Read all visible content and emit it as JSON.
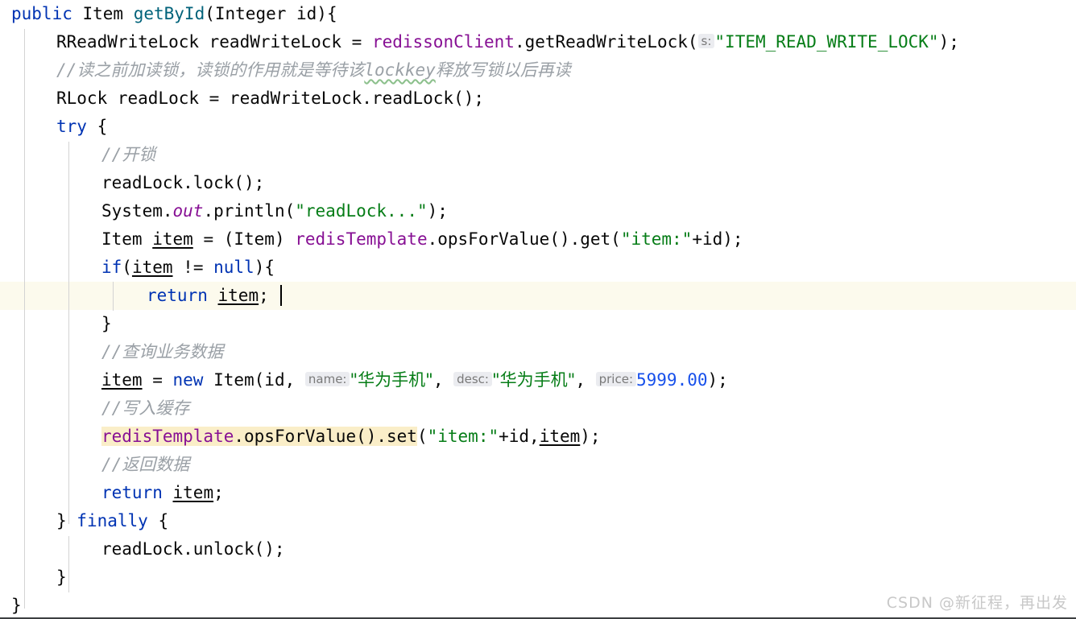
{
  "editor": {
    "language": "Java",
    "theme": "IntelliJ Light",
    "font_size_px": 21,
    "line_height_px": 35,
    "colors": {
      "background": "#ffffff",
      "keyword": "#0033b3",
      "method": "#00627a",
      "field": "#871094",
      "string": "#067d17",
      "number": "#1750eb",
      "comment": "#9aa0a6",
      "default_text": "#080808",
      "caret_line": "#fcfaed",
      "search_highlight": "#faeec8",
      "param_hint_bg": "#ebecf0",
      "param_hint_fg": "#7a7a7a",
      "indent_guide": "#d3d3d3",
      "typo_wave": "#8cc08c"
    },
    "caret_line_number": 9
  },
  "code": {
    "l1": {
      "kw_public": "public",
      "type_item": " Item ",
      "method": "getById",
      "params": "(Integer id){"
    },
    "l2": {
      "type": "RReadWriteLock readWriteLock = ",
      "field": "redissonClient",
      "call": ".getReadWriteLock(",
      "hint": "s:",
      "string": "\"ITEM_READ_WRITE_LOCK\"",
      "tail": ");"
    },
    "l3": {
      "slashes": "//",
      "pre": "读之前加读锁，读锁的作用就是等待该",
      "typo": "lockkey",
      "post": "释放写锁以后再读"
    },
    "l4": {
      "text": "RLock readLock = readWriteLock.readLock();"
    },
    "l5": {
      "kw_try": "try",
      "brace": " {"
    },
    "l6": {
      "slashes": "//",
      "text": "开锁"
    },
    "l7": {
      "text": "readLock.lock();"
    },
    "l8": {
      "pre": "System.",
      "static_out": "out",
      "mid": ".println(",
      "string": "\"readLock...\"",
      "tail": ");"
    },
    "l9": {
      "pre": "Item ",
      "var": "item",
      "mid": " = (Item) ",
      "field": "redisTemplate",
      "call": ".opsForValue().get(",
      "string": "\"item:\"",
      "tail": "+id);"
    },
    "l10": {
      "kw_if": "if",
      "paren": "(",
      "var": "item",
      "mid": " != ",
      "kw_null": "null",
      "tail": "){"
    },
    "l11": {
      "kw_return": "return",
      "space": " ",
      "var": "item",
      "semi": ";"
    },
    "l12": {
      "text": "}"
    },
    "l13": {
      "slashes": "//",
      "text": "查询业务数据"
    },
    "l14": {
      "var": "item",
      "eq": " = ",
      "kw_new": "new",
      "ctor": " Item(id, ",
      "hint_name": "name:",
      "str_name": "\"华为手机\"",
      "comma1": ", ",
      "hint_desc": "desc:",
      "str_desc": "\"华为手机\"",
      "comma2": ", ",
      "hint_price": "price:",
      "num_price": "5999.00",
      "tail": ");"
    },
    "l15": {
      "slashes": "//",
      "text": "写入缓存"
    },
    "l16": {
      "hl_field": "redisTemplate",
      "hl_call": ".opsForValue().set",
      "paren": "(",
      "string": "\"item:\"",
      "mid": "+id,",
      "var": "item",
      "tail": ");"
    },
    "l17": {
      "slashes": "//",
      "text": "返回数据"
    },
    "l18": {
      "kw_return": "return",
      "space": " ",
      "var": "item",
      "semi": ";"
    },
    "l19": {
      "brace": "} ",
      "kw_finally": "finally",
      "tail": " {"
    },
    "l20": {
      "text": "readLock.unlock();"
    },
    "l21": {
      "text": "}"
    },
    "l22": {
      "text": "}"
    }
  },
  "watermark": {
    "text": "CSDN @新征程，再出发"
  }
}
